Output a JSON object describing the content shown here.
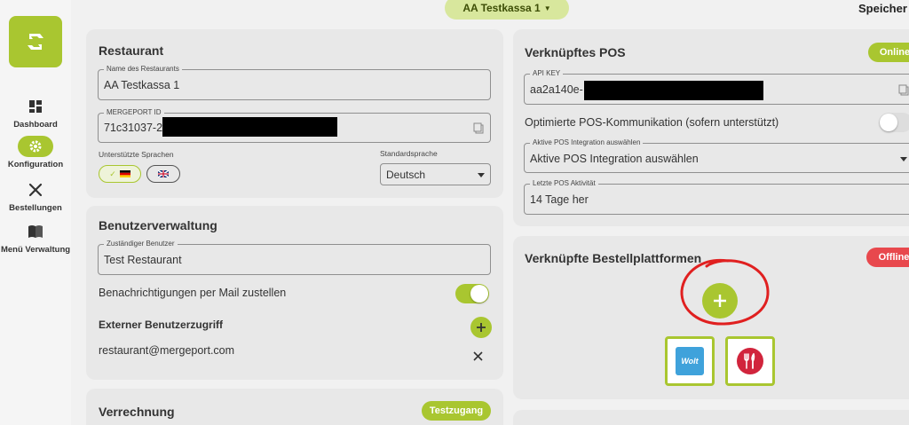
{
  "sidebar": {
    "items": [
      {
        "label": "Dashboard",
        "icon": "dashboard-icon"
      },
      {
        "label": "Konfiguration",
        "icon": "gear-icon",
        "active": true
      },
      {
        "label": "Bestellungen",
        "icon": "cutlery-icon"
      },
      {
        "label": "Menü Verwaltung",
        "icon": "book-icon"
      }
    ]
  },
  "header": {
    "kasse_label": "AA Testkassa 1",
    "save_label": "Speicher"
  },
  "restaurant": {
    "title": "Restaurant",
    "name_label": "Name des Restaurants",
    "name_value": "AA Testkassa 1",
    "mergeport_label": "MERGEPORT ID",
    "mergeport_value": "71c31037-2",
    "languages_label": "Unterstützte Sprachen",
    "default_lang_label": "Standardsprache",
    "default_lang_value": "Deutsch",
    "languages_selected_mark": "✓"
  },
  "users": {
    "title": "Benutzerverwaltung",
    "responsible_label": "Zuständiger Benutzer",
    "responsible_value": "Test Restaurant",
    "notify_label": "Benachrichtigungen per Mail zustellen",
    "external_title": "Externer Benutzerzugriff",
    "external_email": "restaurant@mergeport.com"
  },
  "billing": {
    "title": "Verrechnung",
    "badge": "Testzugang"
  },
  "pos": {
    "title": "Verknüpftes POS",
    "status": "Online",
    "api_label": "API KEY",
    "api_value": "aa2a140e-",
    "optimized_label": "Optimierte POS-Kommunikation (sofern unterstützt)",
    "integration_label": "Aktive POS Integration auswählen",
    "integration_value": "Aktive POS Integration auswählen",
    "last_activity_label": "Letzte POS Aktivität",
    "last_activity_value": "14 Tage her"
  },
  "platforms": {
    "title": "Verknüpfte Bestellplattformen",
    "status": "Offline",
    "wolt_label": "Wolt"
  },
  "colors": {
    "accent": "#a9c630",
    "online": "#a9c630",
    "offline": "#e8484d",
    "annotation": "#e02020"
  }
}
